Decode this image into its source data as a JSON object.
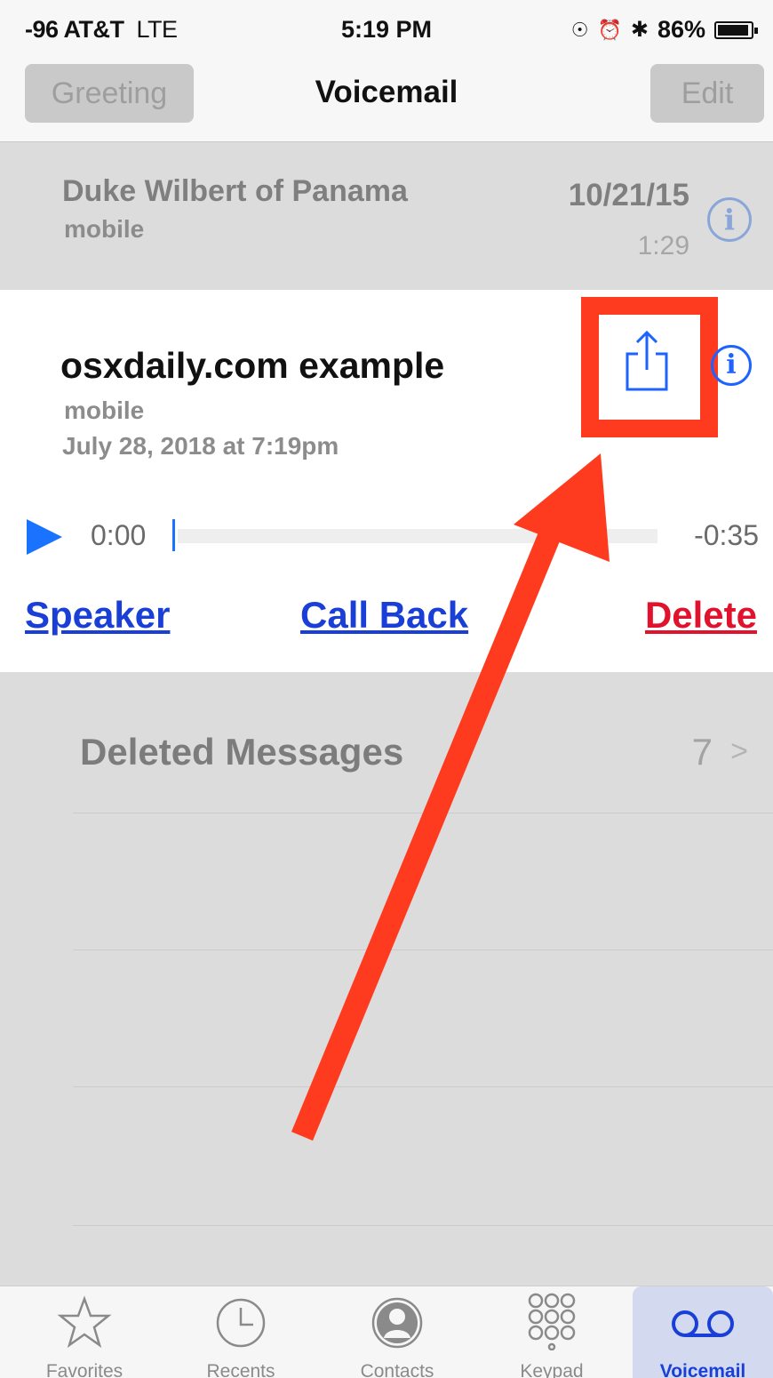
{
  "status_bar": {
    "carrier": "-96 AT&T",
    "network": "LTE",
    "time": "5:19 PM",
    "battery": "86%"
  },
  "nav": {
    "greeting_label": "Greeting",
    "title": "Voicemail",
    "edit_label": "Edit"
  },
  "voicemails": [
    {
      "name": "Duke Wilbert of Panama",
      "type": "mobile",
      "date": "10/21/15",
      "duration": "1:29"
    }
  ],
  "expanded": {
    "name": "osxdaily.com example",
    "type": "mobile",
    "datetime": "July 28, 2018 at 7:19pm",
    "elapsed": "0:00",
    "remaining": "-0:35",
    "progress": 0,
    "actions": {
      "speaker": "Speaker",
      "call_back": "Call Back",
      "delete": "Delete"
    }
  },
  "deleted": {
    "label": "Deleted Messages",
    "count": "7"
  },
  "tabs": [
    {
      "label": "Favorites",
      "icon": "star-icon"
    },
    {
      "label": "Recents",
      "icon": "clock-icon"
    },
    {
      "label": "Contacts",
      "icon": "contact-icon"
    },
    {
      "label": "Keypad",
      "icon": "keypad-icon"
    },
    {
      "label": "Voicemail",
      "icon": "voicemail-icon",
      "selected": true
    }
  ],
  "colors": {
    "accent": "#1a3fd6",
    "delete": "#e0122e",
    "annotation": "#ff3b1f",
    "play": "#1a73ff"
  }
}
